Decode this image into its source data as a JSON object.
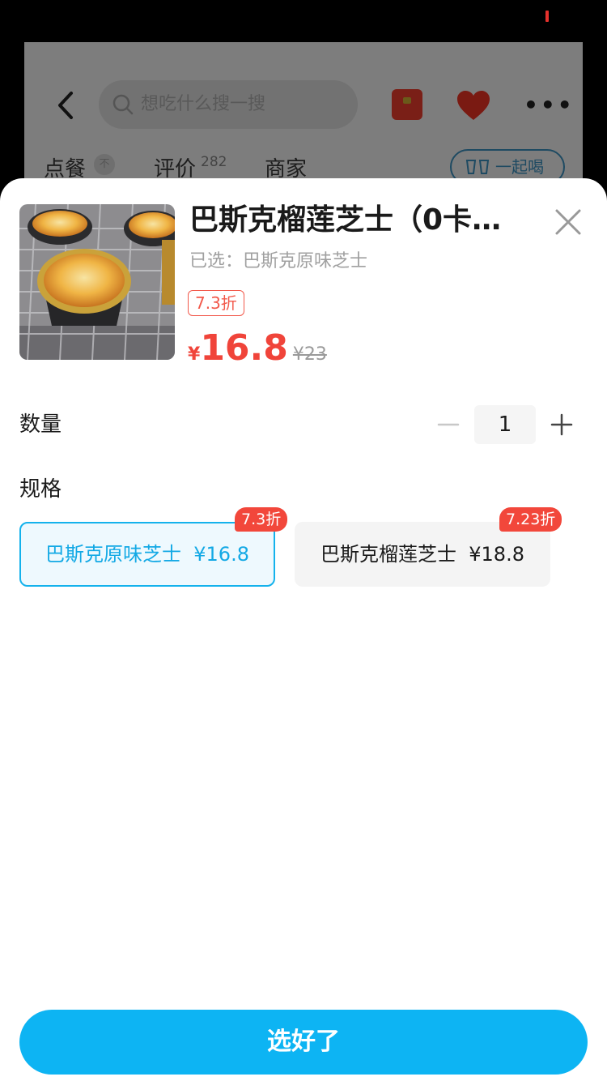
{
  "background_page": {
    "search": {
      "placeholder": "想吃什么搜一搜"
    },
    "tabs": [
      {
        "label": "点餐",
        "badge": "不"
      },
      {
        "label": "评价",
        "count": "282"
      },
      {
        "label": "商家"
      }
    ],
    "together_button": "一起喝"
  },
  "sheet": {
    "product": {
      "title": "巴斯克榴莲芝士（0卡糖…",
      "selected_text": "已选：巴斯克原味芝士",
      "discount": "7.3折",
      "price_symbol": "¥",
      "price": "16.8",
      "original_price": "¥23"
    },
    "quantity": {
      "label": "数量",
      "value": "1"
    },
    "spec": {
      "label": "规格",
      "options": [
        {
          "label": "巴斯克原味芝士  ¥16.8",
          "badge": "7.3折",
          "selected": true
        },
        {
          "label": "巴斯克榴莲芝士  ¥18.8",
          "badge": "7.23折",
          "selected": false
        }
      ]
    },
    "confirm_button": "选好了"
  },
  "colors": {
    "accent": "#0db4f3",
    "price": "#f0443a",
    "badge": "#f2473b"
  }
}
